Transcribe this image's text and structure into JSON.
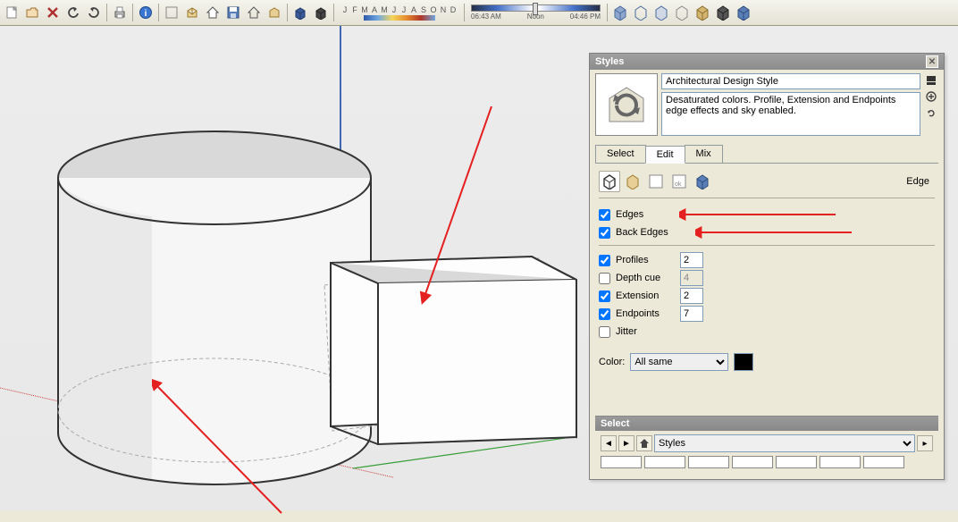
{
  "toolbar": {
    "months": [
      "J",
      "F",
      "M",
      "A",
      "M",
      "J",
      "J",
      "A",
      "S",
      "O",
      "N",
      "D"
    ],
    "time_start": "06:43 AM",
    "time_noon": "Noon",
    "time_end": "04:46 PM"
  },
  "styles_panel": {
    "title": "Styles",
    "style_name": "Architectural Design Style",
    "style_desc": "Desaturated colors. Profile, Extension and Endpoints edge effects and sky enabled.",
    "tabs": {
      "select": "Select",
      "edit": "Edit",
      "mix": "Mix"
    },
    "section_label": "Edge",
    "edge": {
      "edges": {
        "label": "Edges",
        "checked": true
      },
      "back_edges": {
        "label": "Back Edges",
        "checked": true
      },
      "profiles": {
        "label": "Profiles",
        "checked": true,
        "value": "2"
      },
      "depth_cue": {
        "label": "Depth cue",
        "checked": false,
        "value": "4"
      },
      "extension": {
        "label": "Extension",
        "checked": true,
        "value": "2"
      },
      "endpoints": {
        "label": "Endpoints",
        "checked": true,
        "value": "7"
      },
      "jitter": {
        "label": "Jitter",
        "checked": false
      }
    },
    "color_label": "Color:",
    "color_mode": "All same",
    "color_value": "#000000"
  },
  "select_pane": {
    "title": "Select",
    "path": "Styles"
  }
}
